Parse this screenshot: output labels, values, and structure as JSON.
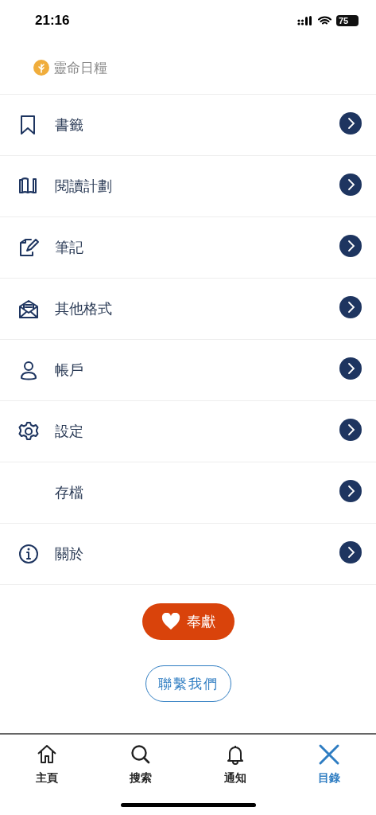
{
  "status_bar": {
    "time": "21:16",
    "battery": "75"
  },
  "brand": {
    "name": "靈命日糧"
  },
  "menu": [
    {
      "label": "書籤"
    },
    {
      "label": "閱讀計劃"
    },
    {
      "label": "筆記"
    },
    {
      "label": "其他格式"
    },
    {
      "label": "帳戶"
    },
    {
      "label": "設定"
    },
    {
      "label": "存檔"
    },
    {
      "label": "關於"
    }
  ],
  "donate_button": {
    "label": "奉獻"
  },
  "contact_button": {
    "label": "聯繫我們"
  },
  "tabs": [
    {
      "label": "主頁",
      "selected": false
    },
    {
      "label": "搜索",
      "selected": false
    },
    {
      "label": "通知",
      "selected": false
    },
    {
      "label": "目錄",
      "selected": true
    }
  ]
}
